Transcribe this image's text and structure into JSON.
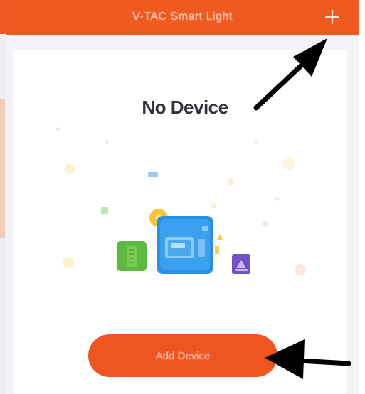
{
  "app": {
    "title": "V-TAC Smart Light"
  },
  "header": {
    "add_icon": "plus-icon"
  },
  "empty_state": {
    "title": "No Device",
    "illustration": "devices-illustration"
  },
  "actions": {
    "add_device_label": "Add Device"
  },
  "colors": {
    "accent": "#ef5a20",
    "background": "#f3f2f6",
    "card": "#ffffff",
    "annotation": "#000000"
  }
}
